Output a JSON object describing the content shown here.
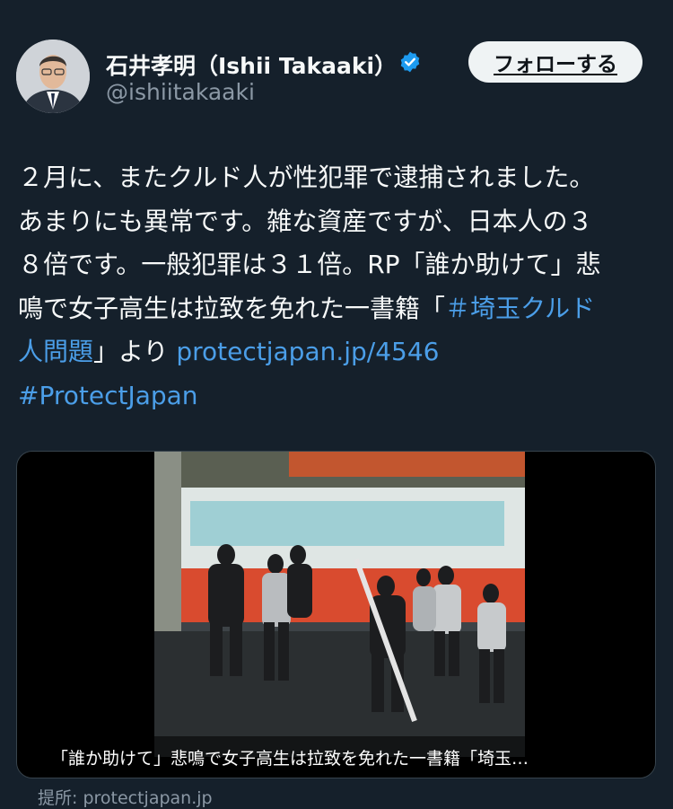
{
  "tweet": {
    "author": {
      "display_name": "石井孝明（Ishii Takaaki）",
      "handle": "@ishiitakaaki",
      "verified": true,
      "avatar_icon": "avatar"
    },
    "follow_button_label": "フォローする",
    "text_lines": [
      [
        {
          "t": "２月に、またクルド人が性犯罪で逮捕されました。"
        }
      ],
      [
        {
          "t": "あまりにも異常です。雑な資産ですが、日本人の３"
        }
      ],
      [
        {
          "t": "８倍です。一般犯罪は３１倍。RP「誰か助けて」悲"
        }
      ],
      [
        {
          "t": "鳴で女子高生は拉致を免れた一書籍「"
        },
        {
          "t": "＃埼玉クルド",
          "link": true
        }
      ],
      [
        {
          "t": "人問題",
          "link": true
        },
        {
          "t": "」より "
        },
        {
          "t": "protectjapan.jp/4546",
          "link": true
        }
      ],
      [
        {
          "t": "#ProtectJapan",
          "link": true
        }
      ]
    ],
    "card": {
      "caption": "「誰か助けて」悲鳴で女子高生は拉致を免れた一書籍「埼玉…",
      "source": "提所: protectjapan.jp"
    },
    "colors": {
      "background": "#15202b",
      "text": "#f7f9f9",
      "secondary": "#8b98a5",
      "link": "#4b9ee8",
      "verified": "#1d9bf0",
      "button_bg": "#eff3f4"
    }
  }
}
